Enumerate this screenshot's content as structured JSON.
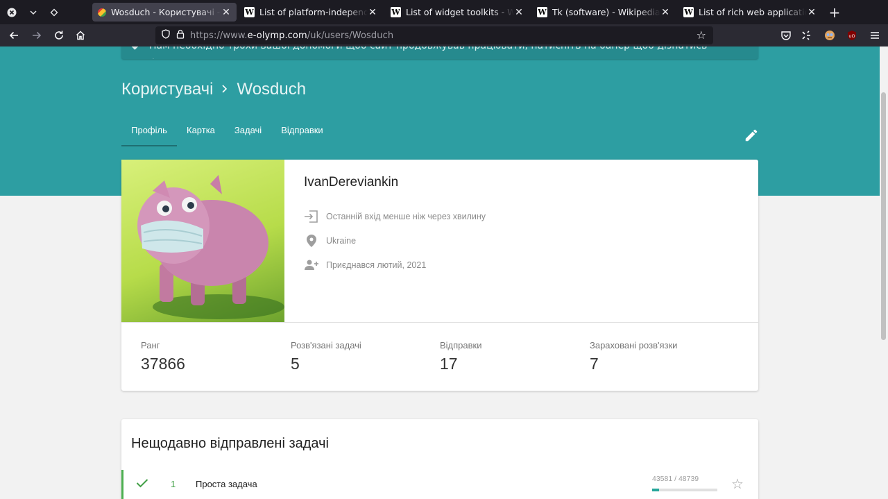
{
  "browser": {
    "tabs": [
      {
        "title": "Wosduch - Користувачі - E-olymp",
        "active": true,
        "favicon": "eolymp-icon"
      },
      {
        "title": "List of platform-independent GUI libraries",
        "active": false,
        "favicon": "wikipedia-icon"
      },
      {
        "title": "List of widget toolkits - Wikipedia",
        "active": false,
        "favicon": "wikipedia-icon"
      },
      {
        "title": "Tk (software) - Wikipedia",
        "active": false,
        "favicon": "wikipedia-icon"
      },
      {
        "title": "List of rich web application frameworks",
        "active": false,
        "favicon": "wikipedia-icon"
      }
    ],
    "url_prefix": "https://www.",
    "url_domain": "e-olymp.com",
    "url_path": "/uk/users/Wosduch",
    "extension_badge": "1"
  },
  "page": {
    "notice_text": "Нам необхідно трохи вашої допомоги щоб сайт продовжував працювати, натисніть на банер щоб дізнатись більше.",
    "breadcrumb": {
      "parent": "Користувачі",
      "current": "Wosduch"
    },
    "tabs": [
      "Профіль",
      "Картка",
      "Задачі",
      "Відправки"
    ],
    "active_tab": "Профіль",
    "profile": {
      "name": "IvanDereviankin",
      "last_login": "Останній вхід менше ніж через хвилину",
      "location": "Ukraine",
      "joined": "Приєднався лютий, 2021"
    },
    "stats": [
      {
        "label": "Ранг",
        "value": "37866"
      },
      {
        "label": "Розв'язані задачі",
        "value": "5"
      },
      {
        "label": "Відправки",
        "value": "17"
      },
      {
        "label": "Зараховані розв'язки",
        "value": "7"
      }
    ],
    "recent": {
      "title": "Нещодавно відправлені задачі",
      "rows": [
        {
          "num": "1",
          "name": "Проста задача",
          "count": "43581 / 48739",
          "ratio": 0.11
        }
      ]
    }
  },
  "colors": {
    "accent": "#2d9ea2",
    "success": "#43a047"
  }
}
